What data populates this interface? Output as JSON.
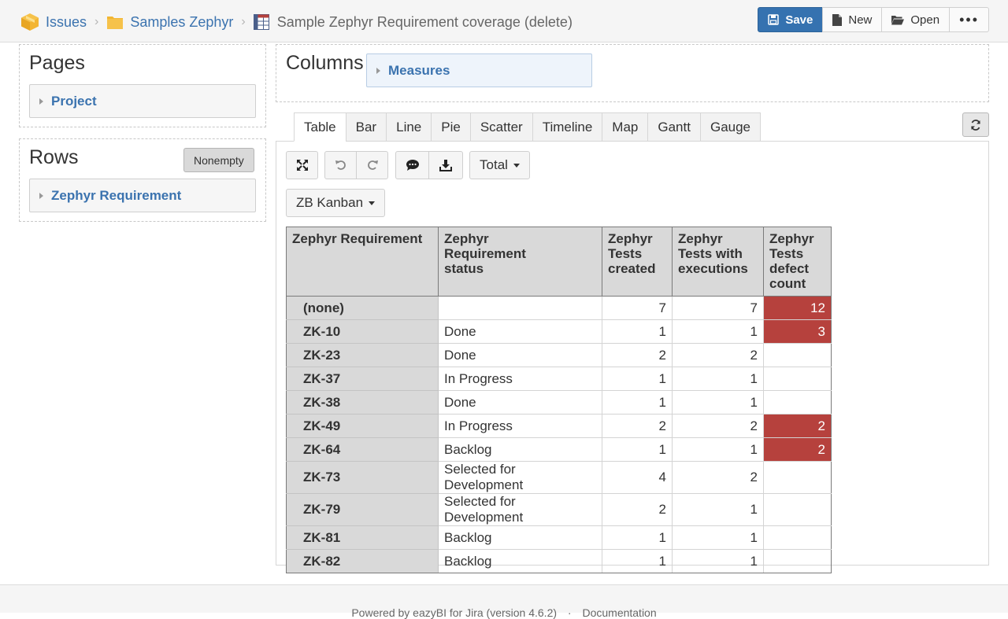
{
  "breadcrumb": {
    "item1": "Issues",
    "item2": "Samples Zephyr",
    "current": "Sample Zephyr Requirement coverage (delete)"
  },
  "toolbar": {
    "save": "Save",
    "new": "New",
    "open": "Open",
    "more": "•••"
  },
  "pages": {
    "title": "Pages",
    "dimension": "Project"
  },
  "rows": {
    "title": "Rows",
    "nonempty": "Nonempty",
    "dimension": "Zephyr Requirement"
  },
  "columns": {
    "title": "Columns",
    "dimension": "Measures"
  },
  "tabs": [
    "Table",
    "Bar",
    "Line",
    "Pie",
    "Scatter",
    "Timeline",
    "Map",
    "Gantt",
    "Gauge"
  ],
  "active_tab": "Table",
  "controls": {
    "total": "Total",
    "board": "ZB Kanban"
  },
  "table": {
    "headers": [
      [
        "Zephyr Requirement"
      ],
      [
        "Zephyr",
        "Requirement",
        "status"
      ],
      [
        "Zephyr",
        "Tests",
        "created"
      ],
      [
        "Zephyr",
        "Tests with",
        "executions"
      ],
      [
        "Zephyr",
        "Tests",
        "defect",
        "count"
      ]
    ],
    "rows": [
      {
        "name": "(none)",
        "status": "",
        "created": "7",
        "executions": "7",
        "defects": "12"
      },
      {
        "name": "ZK-10",
        "status": "Done",
        "created": "1",
        "executions": "1",
        "defects": "3"
      },
      {
        "name": "ZK-23",
        "status": "Done",
        "created": "2",
        "executions": "2",
        "defects": ""
      },
      {
        "name": "ZK-37",
        "status": "In Progress",
        "created": "1",
        "executions": "1",
        "defects": ""
      },
      {
        "name": "ZK-38",
        "status": "Done",
        "created": "1",
        "executions": "1",
        "defects": ""
      },
      {
        "name": "ZK-49",
        "status": "In Progress",
        "created": "2",
        "executions": "2",
        "defects": "2"
      },
      {
        "name": "ZK-64",
        "status": "Backlog",
        "created": "1",
        "executions": "1",
        "defects": "2"
      },
      {
        "name": "ZK-73",
        "status": "Selected for Development",
        "created": "4",
        "executions": "2",
        "defects": ""
      },
      {
        "name": "ZK-79",
        "status": "Selected for Development",
        "created": "2",
        "executions": "1",
        "defects": ""
      },
      {
        "name": "ZK-81",
        "status": "Backlog",
        "created": "1",
        "executions": "1",
        "defects": ""
      },
      {
        "name": "ZK-82",
        "status": "Backlog",
        "created": "1",
        "executions": "1",
        "defects": ""
      }
    ],
    "highlight_color": "#b6413d"
  },
  "footer": {
    "powered": "Powered by eazyBI for Jira (version 4.6.2)",
    "separator": "·",
    "docs": "Documentation"
  },
  "colors": {
    "accent": "#3572b0",
    "link": "#3b73af"
  }
}
